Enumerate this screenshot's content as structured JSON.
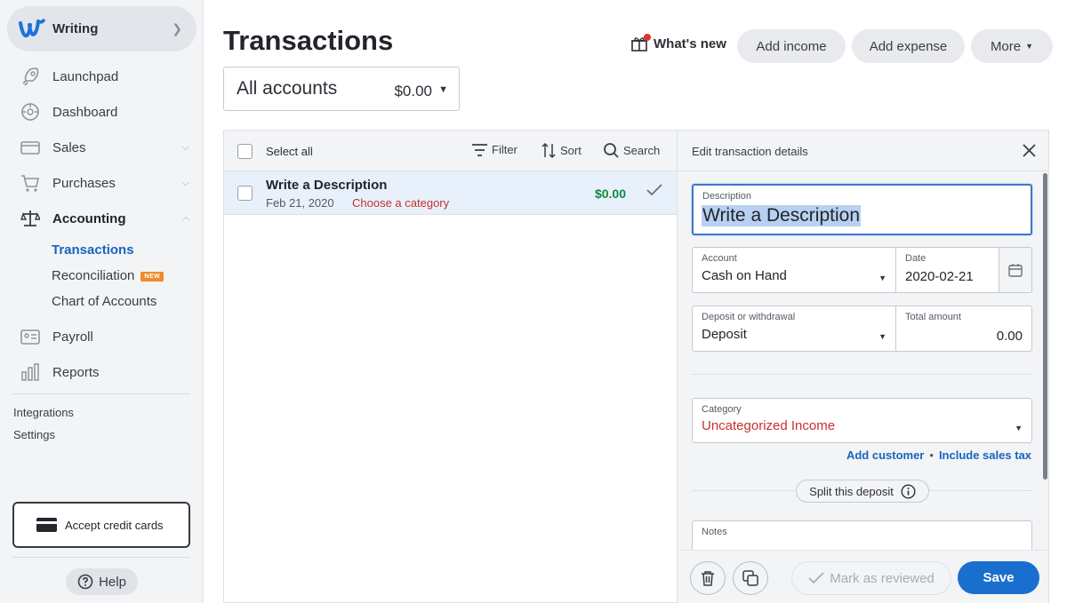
{
  "sidebar": {
    "business_name": "Writing",
    "nav": {
      "launchpad": "Launchpad",
      "dashboard": "Dashboard",
      "sales": "Sales",
      "purchases": "Purchases",
      "accounting": "Accounting",
      "payroll": "Payroll",
      "reports": "Reports"
    },
    "accounting_sub": {
      "transactions": "Transactions",
      "reconciliation": "Reconciliation",
      "new_badge": "NEW",
      "chart_of_accounts": "Chart of Accounts"
    },
    "integrations": "Integrations",
    "settings": "Settings",
    "accept_cards": "Accept credit cards",
    "help": "Help"
  },
  "header": {
    "title": "Transactions",
    "whats_new": "What's new",
    "add_income": "Add income",
    "add_expense": "Add expense",
    "more": "More"
  },
  "account_select": {
    "name": "All accounts",
    "amount": "$0.00"
  },
  "list": {
    "select_all": "Select all",
    "filter": "Filter",
    "sort": "Sort",
    "search": "Search",
    "rows": [
      {
        "description": "Write a Description",
        "date": "Feb 21, 2020",
        "category": "Choose a category",
        "amount": "$0.00"
      }
    ]
  },
  "edit": {
    "title": "Edit transaction details",
    "description_label": "Description",
    "description_value": "Write a Description",
    "account_label": "Account",
    "account_value": "Cash on Hand",
    "date_label": "Date",
    "date_value": "2020-02-21",
    "type_label": "Deposit or withdrawal",
    "type_value": "Deposit",
    "total_label": "Total amount",
    "total_value": "0.00",
    "category_label": "Category",
    "category_value": "Uncategorized Income",
    "add_customer": "Add customer",
    "link_sep": "•",
    "include_tax": "Include sales tax",
    "split": "Split this deposit",
    "notes_label": "Notes",
    "mark_reviewed": "Mark as reviewed",
    "save": "Save"
  },
  "colors": {
    "accent_blue": "#1a6fce",
    "link_blue": "#1565c0",
    "amount_green": "#12873f",
    "category_red": "#c9302c",
    "badge_orange": "#ef8a2a"
  },
  "icons": [
    "wave-logo-icon",
    "chevron-right-icon",
    "rocket-icon",
    "dashboard-icon",
    "sales-icon",
    "cart-icon",
    "scale-icon",
    "payroll-icon",
    "reports-icon",
    "credit-card-icon",
    "help-icon",
    "gift-icon",
    "filter-icon",
    "sort-icon",
    "search-icon",
    "check-icon",
    "close-icon",
    "calendar-icon",
    "info-icon",
    "trash-icon",
    "copy-icon"
  ]
}
